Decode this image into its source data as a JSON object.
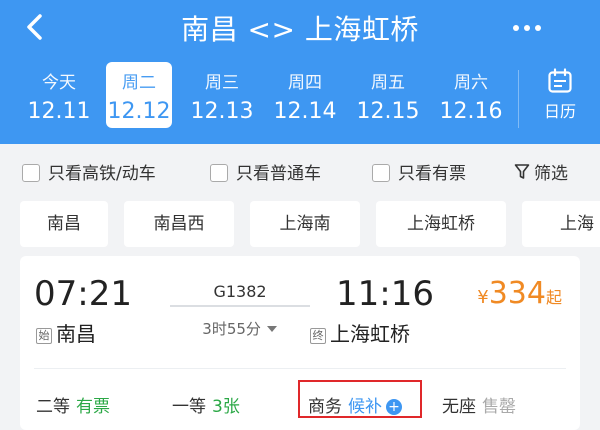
{
  "header": {
    "title": "南昌 <> 上海虹桥",
    "background_color": "#3e97f2",
    "icons": {
      "back": "chevron-left-icon",
      "more": "more-dots-icon"
    }
  },
  "dates": [
    {
      "weekday": "今天",
      "date": "12.11"
    },
    {
      "weekday": "周二",
      "date": "12.12"
    },
    {
      "weekday": "周三",
      "date": "12.13"
    },
    {
      "weekday": "周四",
      "date": "12.14"
    },
    {
      "weekday": "周五",
      "date": "12.15"
    },
    {
      "weekday": "周六",
      "date": "12.16"
    }
  ],
  "selected_date_index": 1,
  "calendar": {
    "label": "日历",
    "icon": "calendar-icon"
  },
  "filters": [
    {
      "label": "只看高铁/动车",
      "checked": false
    },
    {
      "label": "只看普通车",
      "checked": false
    },
    {
      "label": "只看有票",
      "checked": false
    }
  ],
  "screen": {
    "label": "筛选",
    "icon": "filter-icon"
  },
  "stations": [
    "南昌",
    "南昌西",
    "上海南",
    "上海虹桥",
    "上海"
  ],
  "train": {
    "departure_time": "07:21",
    "departure_tag": "始",
    "departure_station": "南昌",
    "train_number": "G1382",
    "duration": "3时55分",
    "arrival_time": "11:16",
    "arrival_tag": "终",
    "arrival_station": "上海虹桥",
    "price_currency": "¥",
    "price": "334",
    "price_suffix": "起",
    "price_color": "#f08a24",
    "seats": [
      {
        "class": "二等",
        "status": "有票"
      },
      {
        "class": "一等",
        "status": "3张"
      },
      {
        "class": "商务",
        "status": "候补"
      },
      {
        "class": "无座",
        "status": "售罄"
      }
    ]
  }
}
